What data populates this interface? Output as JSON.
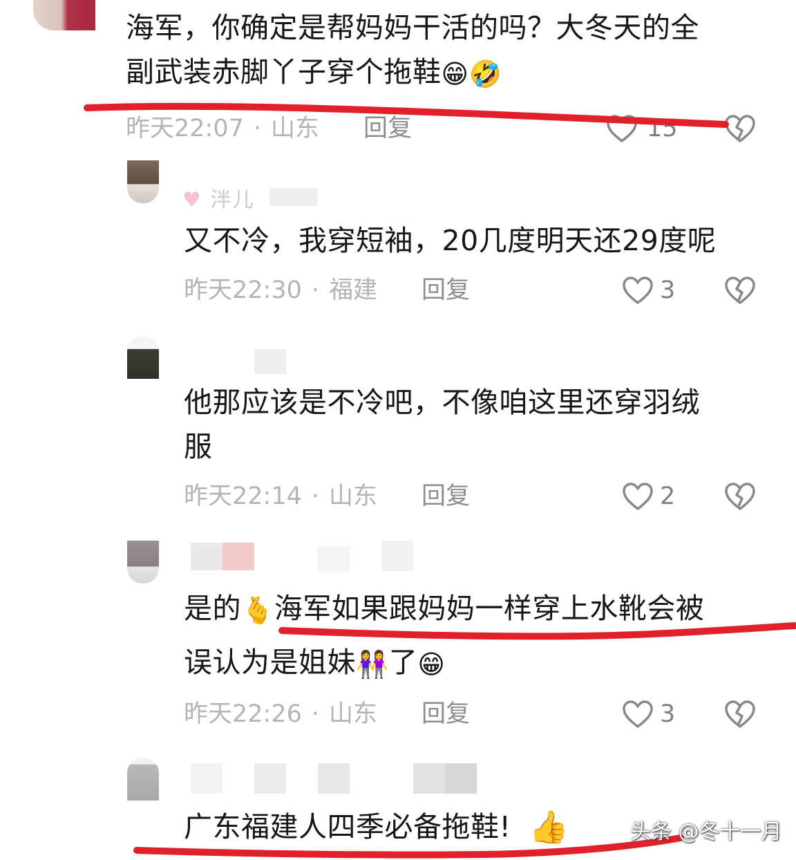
{
  "comments": [
    {
      "level": "top",
      "text_lines": [
        "海军，你确定是帮妈妈干活的吗？大冬天的全",
        "副武装赤脚丫子穿个拖鞋"
      ],
      "emojis": [
        "😁",
        "🤣"
      ],
      "time": "昨天22:07",
      "location": "山东",
      "reply_label": "回复",
      "likes": "15"
    },
    {
      "level": "reply",
      "username_partial": "泮儿",
      "text_lines": [
        "又不冷，我穿短袖，20几度明天还29度呢"
      ],
      "time": "昨天22:30",
      "location": "福建",
      "reply_label": "回复",
      "likes": "3"
    },
    {
      "level": "reply",
      "text_lines": [
        "他那应该是不冷吧，不像咱这里还穿羽绒",
        "服"
      ],
      "time": "昨天22:14",
      "location": "山东",
      "reply_label": "回复",
      "likes": "2"
    },
    {
      "level": "reply",
      "text_parts": {
        "line1_a": "是的",
        "line1_b": "海军如果跟妈妈一样穿上水靴会被",
        "line2_a": "误认为是姐妹",
        "line2_b": "了"
      },
      "emojis": [
        "🫰",
        "👭",
        "😁"
      ],
      "time": "昨天22:26",
      "location": "山东",
      "reply_label": "回复",
      "likes": "3"
    },
    {
      "level": "reply",
      "text_lines": [
        "广东福建人四季必备拖鞋!"
      ],
      "emojis": [
        "👍"
      ]
    }
  ],
  "separator": "·",
  "watermark": "头条 @冬十一月",
  "icons": {
    "like": "heart-outline-icon",
    "dislike": "broken-heart-icon"
  },
  "colors": {
    "highlight_ink": "#e0202b",
    "meta_text": "#b4b4b4",
    "icon_stroke": "#888888"
  }
}
